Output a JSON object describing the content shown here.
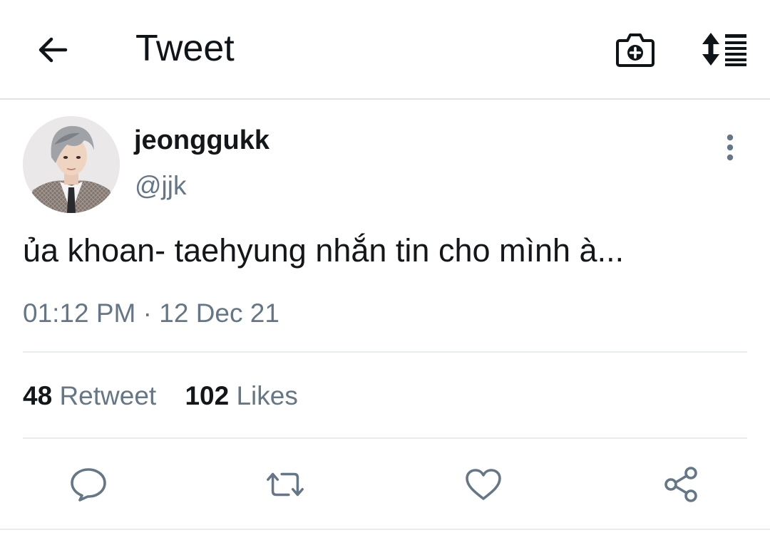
{
  "header": {
    "title": "Tweet",
    "icons": {
      "back": "arrow-left-icon",
      "camera": "camera-plus-icon",
      "sort": "sort-list-icon"
    }
  },
  "tweet": {
    "display_name": "jeonggukk",
    "handle": "@jjk",
    "text": "ủa khoan- taehyung nhắn tin cho mình à...",
    "time": "01:12 PM",
    "separator": "·",
    "date": "12 Dec 21",
    "stats": {
      "retweets_count": "48",
      "retweets_label": "Retweet",
      "likes_count": "102",
      "likes_label": "Likes"
    }
  },
  "actions": [
    "reply-icon",
    "retweet-icon",
    "like-icon",
    "share-icon"
  ],
  "colors": {
    "text_primary": "#14171a",
    "text_secondary": "#657786",
    "icon": "#657786",
    "divider": "#e6ecf0"
  }
}
